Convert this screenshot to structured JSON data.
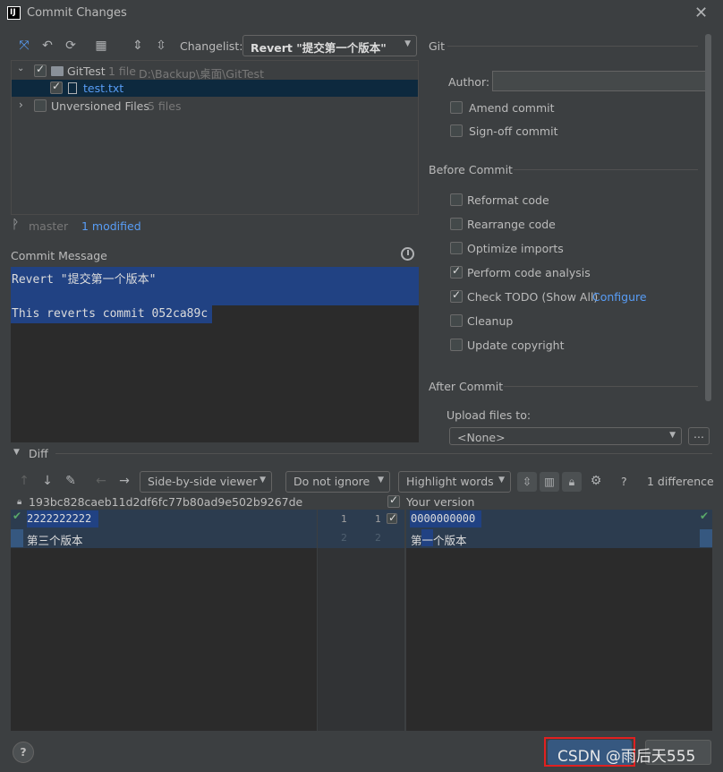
{
  "window": {
    "title": "Commit Changes"
  },
  "toolbar": {
    "changelist_label": "Changelist:",
    "changelist_value": "Revert \"提交第一个版本\""
  },
  "tree": {
    "root": {
      "name": "GitTest",
      "count": "1 file",
      "path": "D:\\Backup\\桌面\\GitTest"
    },
    "file": {
      "name": "test.txt"
    },
    "unversioned": {
      "name": "Unversioned Files",
      "count": "5 files"
    }
  },
  "status": {
    "branch": "master",
    "modified": "1 modified"
  },
  "commit": {
    "label": "Commit Message",
    "line1": "Revert \"提交第一个版本\"",
    "line2": "This reverts commit 052ca89c"
  },
  "git": {
    "title": "Git",
    "author_label": "Author:",
    "amend": "Amend commit",
    "signoff": "Sign-off commit"
  },
  "before": {
    "title": "Before Commit",
    "reformat": "Reformat code",
    "rearrange": "Rearrange code",
    "optimize": "Optimize imports",
    "analysis": "Perform code analysis",
    "todo": "Check TODO (Show All)",
    "configure": "Configure",
    "cleanup": "Cleanup",
    "copyright": "Update copyright"
  },
  "after": {
    "title": "After Commit",
    "upload_label": "Upload files to:",
    "upload_value": "<None>",
    "more": "..."
  },
  "diff": {
    "title": "Diff",
    "viewer": "Side-by-side viewer",
    "ignore": "Do not ignore",
    "highlight": "Highlight words",
    "help": "?",
    "differences": "1 difference",
    "left_header": "193bc828caeb11d2df6fc77b80ad9e502b9267de",
    "right_header": "Your version",
    "left_line1": "2222222222",
    "left_line2": "第三个版本",
    "right_line1": "0000000000",
    "right_line2": "第一个版本",
    "gutter": [
      "1",
      "1",
      "2",
      "2"
    ]
  },
  "footer": {
    "help": "?",
    "watermark": "CSDN @雨后天555"
  }
}
